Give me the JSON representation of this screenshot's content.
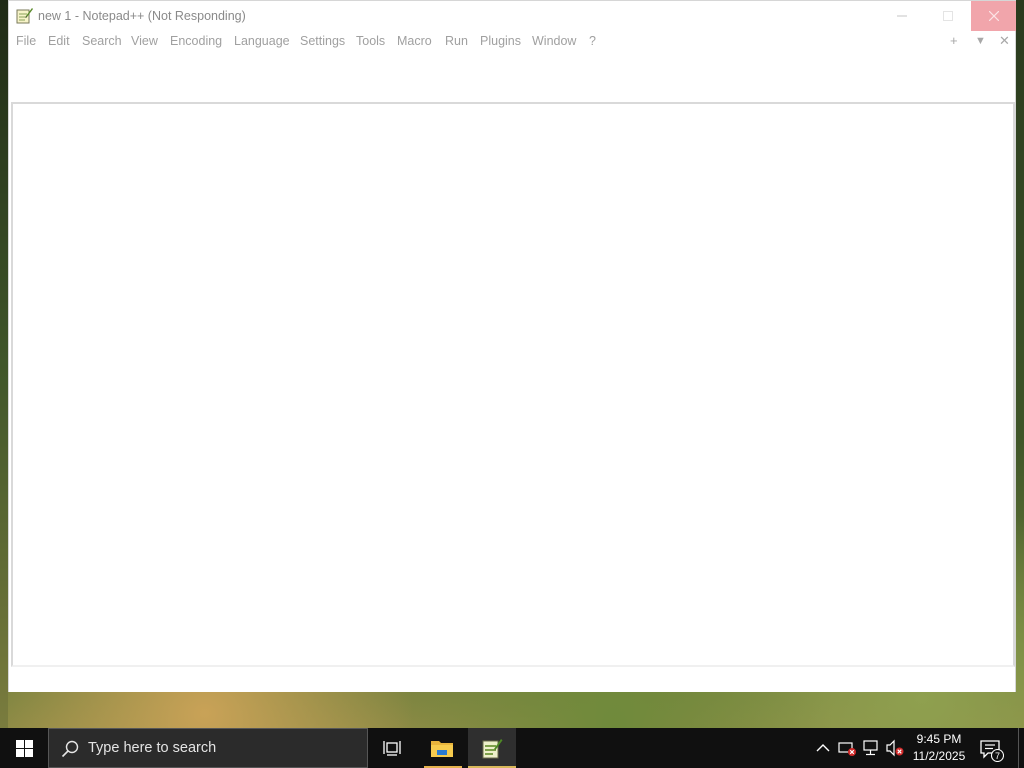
{
  "window": {
    "title": "new 1 - Notepad++ (Not Responding)",
    "menu": [
      "File",
      "Edit",
      "Search",
      "View",
      "Encoding",
      "Language",
      "Settings",
      "Tools",
      "Macro",
      "Run",
      "Plugins",
      "Window",
      "?"
    ],
    "menu_right": {
      "add": "+",
      "dropdown": "▼",
      "close": "✕"
    },
    "controls": {
      "minimize": "—",
      "maximize": "☐",
      "close": "✕"
    }
  },
  "taskbar": {
    "search_placeholder": "Type here to search",
    "clock_time": "9:45 PM",
    "clock_date": "11/2/2025",
    "notification_count": "7"
  },
  "icons": {
    "start": "windows-logo-icon",
    "search": "search-icon",
    "task_view": "task-view-icon",
    "explorer": "file-explorer-icon",
    "notepadpp": "notepadpp-icon",
    "tray_chevron": "chevron-up-icon",
    "tray_sync": "sync-error-icon",
    "tray_network": "network-error-icon",
    "tray_volume": "volume-muted-icon",
    "notifications": "action-center-icon"
  },
  "colors": {
    "close_hover": "#f1a5ab",
    "taskbar": "#101010",
    "active_indicator": "#e4b24d"
  }
}
